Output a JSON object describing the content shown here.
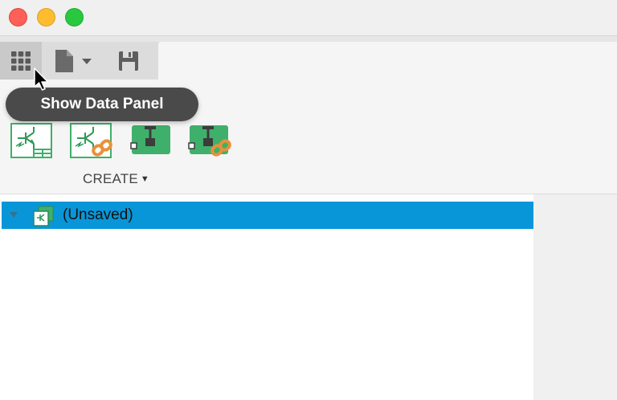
{
  "window": {
    "controls": [
      "close",
      "minimize",
      "zoom"
    ]
  },
  "toolbar": {
    "buttons": [
      {
        "icon": "grid-icon"
      },
      {
        "icon": "file-icon"
      },
      {
        "icon": "save-icon"
      }
    ]
  },
  "tooltip": {
    "text": "Show Data Panel"
  },
  "ribbon": {
    "tools": [
      {
        "icon": "schematic-icon"
      },
      {
        "icon": "schematic-link-icon"
      },
      {
        "icon": "board-icon"
      },
      {
        "icon": "board-link-icon"
      }
    ],
    "create_label": "CREATE",
    "create_caret": "▼"
  },
  "browser": {
    "root_label": "(Unsaved)"
  },
  "colors": {
    "selection": "#0996d8",
    "tool_green": "#3fb06b",
    "link_orange": "#e8913a"
  }
}
